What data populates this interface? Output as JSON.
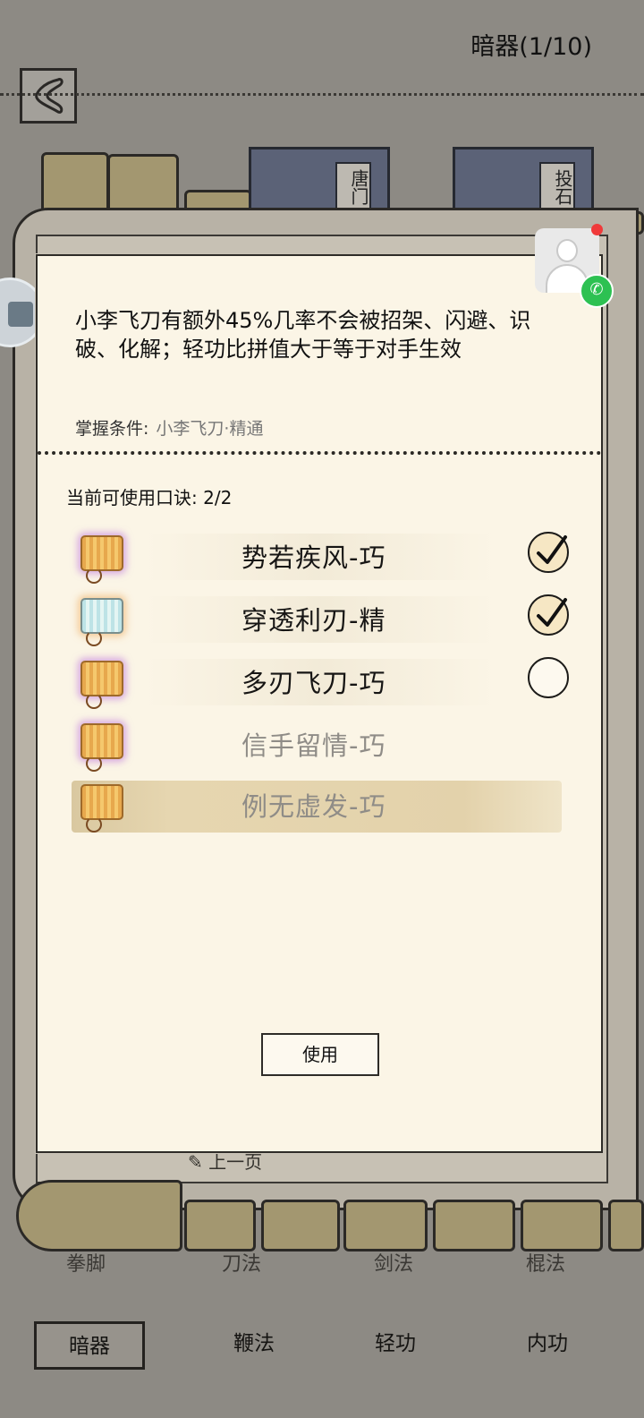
{
  "header": {
    "title": "暗器(1/10)"
  },
  "background": {
    "book_tags": [
      "唐门",
      "投石"
    ],
    "prev_page_label": "上一页",
    "tab_ghost_labels": [
      "拳脚",
      "刀法",
      "剑法",
      "棍法"
    ]
  },
  "panel": {
    "description": "小李飞刀有额外45%几率不会被招架、闪避、识破、化解；轻功比拼值大于等于对手生效",
    "mastery_label": "掌握条件:",
    "mastery_value": "小李飞刀·精通",
    "count_label": "当前可使用口诀:",
    "count_value": "2/2",
    "items": [
      {
        "label": "势若疾风-巧",
        "icon": "gold-scroll-icon",
        "checked": true
      },
      {
        "label": "穿透利刃-精",
        "icon": "blue-scroll-icon",
        "checked": true
      },
      {
        "label": "多刃飞刀-巧",
        "icon": "gold-scroll-icon",
        "checked": false
      },
      {
        "label": "信手留情-巧",
        "icon": "gold-scroll-icon",
        "disabled": true
      },
      {
        "label": "例无虚发-巧",
        "icon": "gold-scroll-icon",
        "disabled": true,
        "highlighted": true
      }
    ],
    "use_button": "使用"
  },
  "tabs": [
    {
      "label": "暗器",
      "active": true
    },
    {
      "label": "鞭法"
    },
    {
      "label": "轻功"
    },
    {
      "label": "内功"
    }
  ],
  "colors": {
    "page_bg": "#8d8a84",
    "panel_bg": "#fbf5e6",
    "dim_text": "#8f8c87",
    "check_fill": "#f6e7c4",
    "notify_dot": "#f03a3a",
    "wechat_green": "#2dc152"
  }
}
